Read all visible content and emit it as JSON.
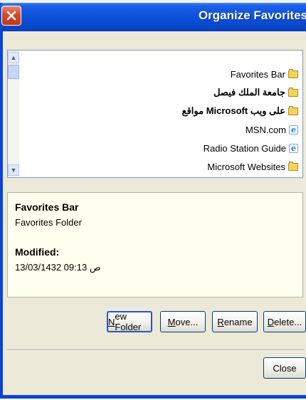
{
  "window": {
    "title": "Organize Favorites"
  },
  "favorites_list": {
    "items": [
      {
        "label": "Favorites Bar",
        "icon": "folder-icon",
        "bold": false
      },
      {
        "label": "جامعة الملك فيصل",
        "icon": "folder-icon",
        "bold": true
      },
      {
        "label": "مواقع Microsoft على ويب",
        "icon": "folder-icon",
        "bold": true
      },
      {
        "label": "MSN.com",
        "icon": "ie-icon",
        "bold": false
      },
      {
        "label": "Radio Station Guide",
        "icon": "ie-icon",
        "bold": false
      },
      {
        "label": "Microsoft Websites",
        "icon": "folder-icon",
        "bold": false
      }
    ]
  },
  "details": {
    "name": "Favorites Bar",
    "type": "Favorites Folder",
    "modified_label": "Modified:",
    "modified_value": "13/03/1432 09:13 ص"
  },
  "buttons": {
    "new_folder": {
      "prefix": "",
      "mnemonic": "N",
      "suffix": "ew Folder"
    },
    "move": {
      "prefix": "",
      "mnemonic": "M",
      "suffix": "ove..."
    },
    "rename": {
      "prefix": "",
      "mnemonic": "R",
      "suffix": "ename"
    },
    "delete": {
      "prefix": "",
      "mnemonic": "D",
      "suffix": "elete..."
    },
    "close": "Close"
  },
  "colors": {
    "titlebar": "#0b4fd9",
    "close_button": "#d4482a",
    "dialog_bg": "#ece9d8",
    "info_bg": "#ffffef"
  }
}
